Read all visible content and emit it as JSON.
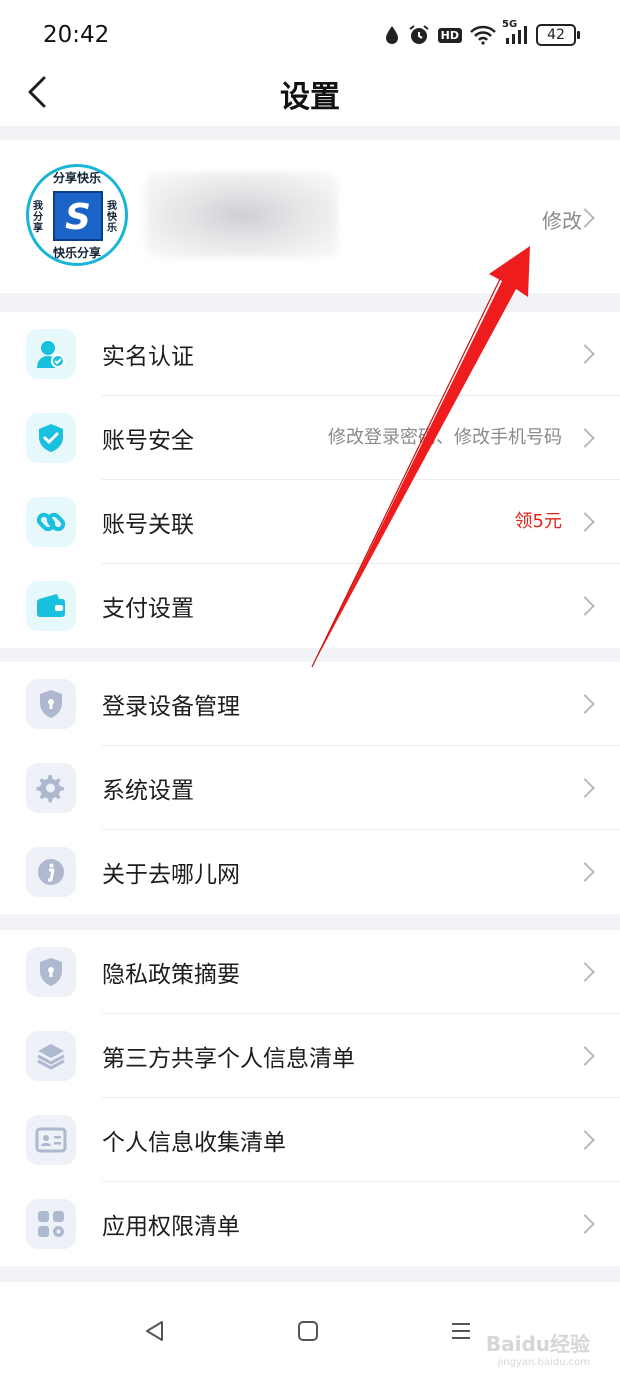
{
  "status_bar": {
    "time": "20:42",
    "battery": "42",
    "hd": "HD",
    "network": "5G"
  },
  "header": {
    "title": "设置"
  },
  "profile": {
    "avatar": {
      "top": "分享快乐",
      "bottom": "快乐分享",
      "left": "我分享",
      "right": "我快乐",
      "letter": "S"
    },
    "edit_label": "修改"
  },
  "groups": [
    {
      "items": [
        {
          "label": "实名认证",
          "right": "",
          "icon": "id-verify-icon"
        },
        {
          "label": "账号安全",
          "right": "修改登录密码、修改手机号码",
          "icon": "shield-check-icon"
        },
        {
          "label": "账号关联",
          "right": "领5元",
          "icon": "link-icon"
        },
        {
          "label": "支付设置",
          "right": "",
          "icon": "wallet-icon"
        }
      ]
    },
    {
      "items": [
        {
          "label": "登录设备管理",
          "icon": "shield-lock-icon"
        },
        {
          "label": "系统设置",
          "icon": "gear-icon"
        },
        {
          "label": "关于去哪儿网",
          "icon": "info-icon"
        }
      ]
    },
    {
      "items": [
        {
          "label": "隐私政策摘要",
          "icon": "privacy-shield-icon"
        },
        {
          "label": "第三方共享个人信息清单",
          "icon": "layers-icon"
        },
        {
          "label": "个人信息收集清单",
          "icon": "id-card-icon"
        },
        {
          "label": "应用权限清单",
          "icon": "grid-apps-icon"
        }
      ]
    }
  ],
  "colors": {
    "accent": "#19c1de",
    "muted_icon": "#aeb8cf",
    "highlight": "#e2231a",
    "annotation_arrow": "#ee1c1c"
  },
  "watermark": {
    "text": "Baidu经验",
    "sub": "jingyan.baidu.com"
  }
}
